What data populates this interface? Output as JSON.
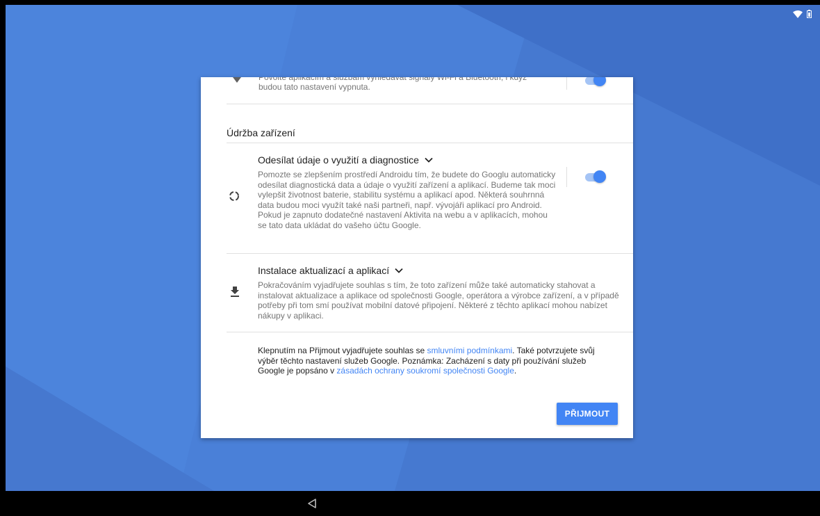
{
  "status_bar": {
    "wifi_icon": "wifi-icon",
    "battery_icon": "battery-icon"
  },
  "colors": {
    "accent": "#4285f4",
    "wallpaper": "#4a80d8",
    "card": "#ffffff",
    "text_primary": "#212121",
    "text_secondary": "#757575"
  },
  "card": {
    "wifi_scan": {
      "description": "Povolte aplikacím a službám vyhledávat signály Wi-Fi a Bluetooth, i když budou tato nastavení vypnuta.",
      "toggle_on": true
    },
    "section_title": "Údržba zařízení",
    "diagnostics": {
      "title": "Odesílat údaje o využití a diagnostice",
      "description": "Pomozte se zlepšením prostředí Androidu tím, že budete do Googlu automaticky odesílat diagnostická data a údaje o využití zařízení a aplikací. Budeme tak moci vylepšit životnost baterie, stabilitu systému a aplikací apod. Některá souhrnná data budou moci využít také naši partneři, např. vývojáři aplikací pro Android. Pokud je zapnuto dodatečné nastavení Aktivita na webu a v aplikacích, mohou se tato data ukládat do vašeho účtu Google.",
      "toggle_on": true
    },
    "updates": {
      "title": "Instalace aktualizací a aplikací",
      "description": "Pokračováním vyjadřujete souhlas s tím, že toto zařízení může také automaticky stahovat a instalovat aktualizace a aplikace od společnosti Google, operátora a výrobce zařízení, a v případě potřeby při tom smí používat mobilní datové připojení. Některé z těchto aplikací mohou nabízet nákupy v aplikaci."
    },
    "consent": {
      "part1": "Klepnutím na Přijmout vyjadřujete souhlas se ",
      "link1": "smluvními podmínkami",
      "part2": ". Také potvrzujete svůj výběr těchto nastavení služeb Google. Poznámka: Zacházení s daty při používání služeb Google je popsáno v ",
      "link2": "zásadách ochrany soukromí společnosti Google",
      "part3": "."
    },
    "accept_label": "PŘIJMOUT"
  },
  "nav_bar": {
    "back_icon": "back-icon"
  }
}
